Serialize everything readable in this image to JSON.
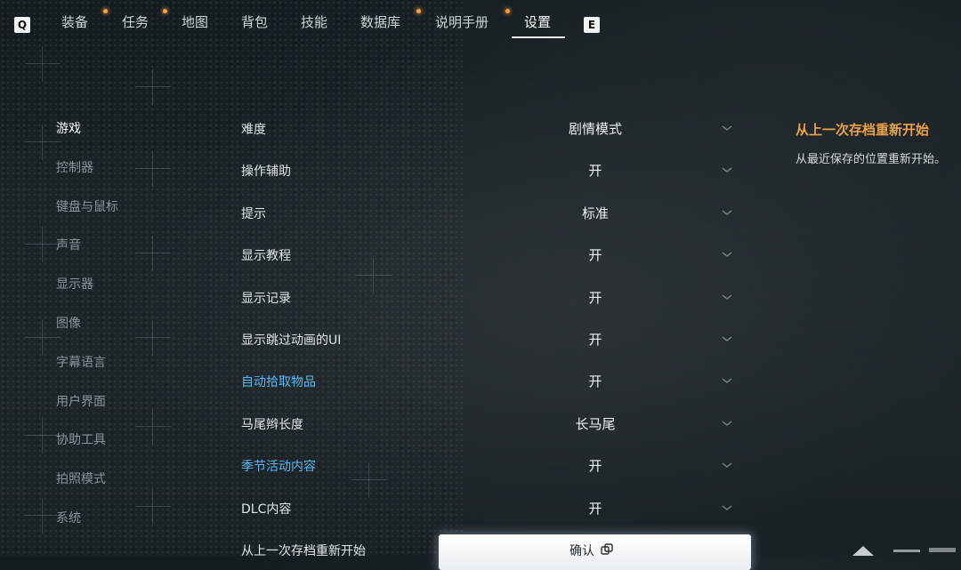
{
  "topbar": {
    "left_key": "Q",
    "right_key": "E",
    "tabs": [
      {
        "label": "装备",
        "has_dot": true
      },
      {
        "label": "任务",
        "has_dot": true
      },
      {
        "label": "地图",
        "has_dot": false
      },
      {
        "label": "背包",
        "has_dot": false
      },
      {
        "label": "技能",
        "has_dot": false
      },
      {
        "label": "数据库",
        "has_dot": true
      },
      {
        "label": "说明手册",
        "has_dot": true
      },
      {
        "label": "设置",
        "has_dot": false,
        "active": true
      }
    ],
    "dot_color": "#f0a050"
  },
  "categories": [
    {
      "label": "游戏",
      "active": true
    },
    {
      "label": "控制器"
    },
    {
      "label": "键盘与鼠标"
    },
    {
      "label": "声音"
    },
    {
      "label": "显示器"
    },
    {
      "label": "图像"
    },
    {
      "label": "字幕语言"
    },
    {
      "label": "用户界面"
    },
    {
      "label": "协助工具"
    },
    {
      "label": "拍照模式"
    },
    {
      "label": "系统"
    }
  ],
  "settings": [
    {
      "label": "难度",
      "value": "剧情模式"
    },
    {
      "label": "操作辅助",
      "value": "开"
    },
    {
      "label": "提示",
      "value": "标准"
    },
    {
      "label": "显示教程",
      "value": "开"
    },
    {
      "label": "显示记录",
      "value": "开"
    },
    {
      "label": "显示跳过动画的UI",
      "value": "开"
    },
    {
      "label": "自动拾取物品",
      "value": "开",
      "highlight": true
    },
    {
      "label": "马尾辫长度",
      "value": "长马尾"
    },
    {
      "label": "季节活动内容",
      "value": "开",
      "highlight": true
    },
    {
      "label": "DLC内容",
      "value": "开"
    },
    {
      "label": "从上一次存档重新开始",
      "value": ""
    }
  ],
  "description": {
    "title": "从上一次存档重新开始",
    "text": "从最近保存的位置重新开始。"
  },
  "confirm_button": {
    "label": "确认",
    "icon": "external-link-icon"
  },
  "colors": {
    "accent_orange": "#e8a24a",
    "highlight_blue": "#5cb8f0"
  }
}
